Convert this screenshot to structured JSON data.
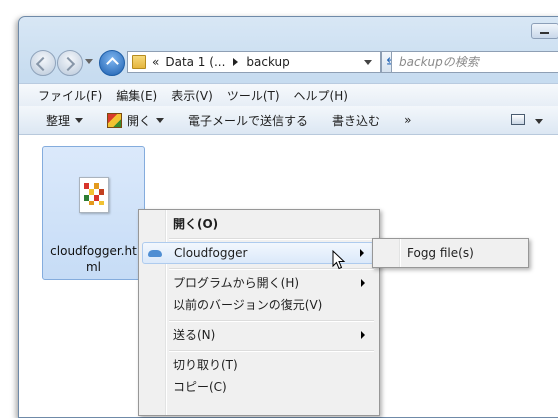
{
  "window": {
    "address": {
      "overflow": "«",
      "segments": [
        "Data 1 (...",
        "backup"
      ]
    },
    "search_placeholder": "backupの検索"
  },
  "menubar": [
    "ファイル(F)",
    "編集(E)",
    "表示(V)",
    "ツール(T)",
    "ヘルプ(H)"
  ],
  "toolbar": {
    "organize": "整理",
    "open": "開く",
    "email": "電子メールで送信する",
    "burn": "書き込む",
    "more": "»"
  },
  "file": {
    "name": "cloudfogger.html"
  },
  "context_menu": {
    "items": [
      {
        "label": "開く(O)",
        "bold": true
      },
      {
        "label": "Cloudfogger",
        "submenu": true,
        "highlighted": true,
        "icon": "cloud-icon"
      },
      {
        "label": "プログラムから開く(H)",
        "submenu": true
      },
      {
        "label": "以前のバージョンの復元(V)"
      },
      {
        "label": "送る(N)",
        "submenu": true
      },
      {
        "label": "切り取り(T)"
      },
      {
        "label": "コピー(C)"
      }
    ]
  },
  "submenu": {
    "items": [
      "Fogg file(s)"
    ]
  }
}
